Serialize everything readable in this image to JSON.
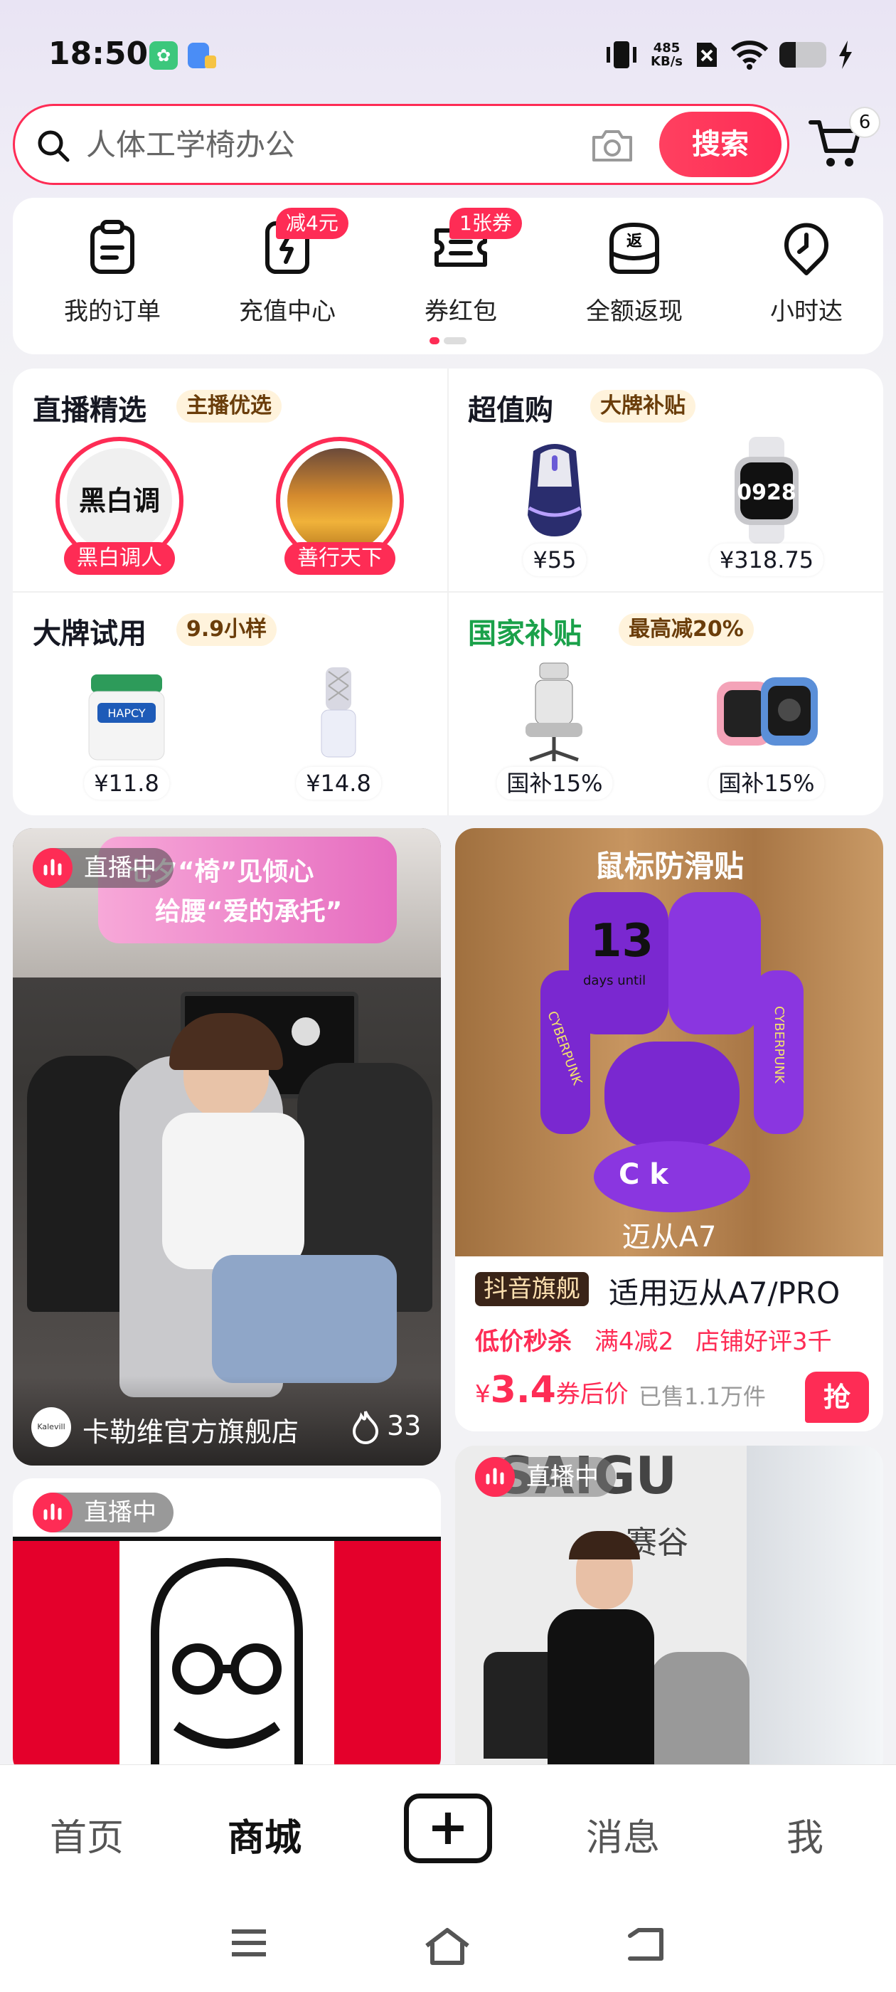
{
  "status": {
    "time": "18:50",
    "net_speed_top": "485",
    "net_speed_bottom": "KB/s",
    "battery_level": 0.35
  },
  "search": {
    "placeholder": "人体工学椅办公",
    "button": "搜索",
    "cart_count": "6"
  },
  "quick_entries": [
    {
      "label": "我的订单",
      "icon": "order-icon",
      "badge": ""
    },
    {
      "label": "充值中心",
      "icon": "phone-charge-icon",
      "badge": "减4元"
    },
    {
      "label": "券红包",
      "icon": "coupon-icon",
      "badge": "1张券"
    },
    {
      "label": "全额返现",
      "icon": "cashback-icon",
      "badge": ""
    },
    {
      "label": "小时达",
      "icon": "clock-pin-icon",
      "badge": ""
    }
  ],
  "sections": {
    "live_pick": {
      "title": "直播精选",
      "tag": "主播优选",
      "anchors": [
        {
          "name": "黑白调人",
          "logo_text": "黑白调"
        },
        {
          "name": "善行天下"
        }
      ]
    },
    "value_buy": {
      "title": "超值购",
      "tag": "大牌补贴",
      "products": [
        {
          "price": "¥55",
          "img": "mouse"
        },
        {
          "price": "¥318.75",
          "img": "smartwatch",
          "watch_text": "0928"
        }
      ]
    },
    "brand_trial": {
      "title": "大牌试用",
      "tag": "9.9小样",
      "products": [
        {
          "price": "¥11.8",
          "img": "cream-jar",
          "jar_text": "HAPCY"
        },
        {
          "price": "¥14.8",
          "img": "perfume-bottle"
        }
      ]
    },
    "gov_subsidy": {
      "title": "国家补贴",
      "tag": "最高减20%",
      "products": [
        {
          "price": "国补15%",
          "img": "office-chair"
        },
        {
          "price": "国补15%",
          "img": "kids-watch"
        }
      ]
    }
  },
  "feed": {
    "card1": {
      "live": "直播中",
      "banner_line1": "七夕“椅”见倾心",
      "banner_line2": "给腰“爱的承托”",
      "shop": "卡勒维官方旗舰店",
      "shop_logo": "Kalevill",
      "heat": "33"
    },
    "card2": {
      "image_title": "鼠标防滑贴",
      "image_caption": "迈从A7",
      "sticker_13": "13",
      "sticker_days": "days until",
      "cyber_text": "CYBERPUNK",
      "sticker_bottom": "C k",
      "flagship_tag": "抖音旗舰",
      "title": "适用迈从A7/PRO",
      "tag1": "低价秒杀",
      "tag2": "满4减2",
      "tag3": "店铺好评3千",
      "price_symbol": "¥",
      "price": "3.4",
      "price_suffix": "券后价",
      "sold": "已售1.1万件",
      "grab": "抢"
    },
    "card3": {
      "live": "直播中"
    },
    "card4": {
      "live": "直播中",
      "brand_en": "SAIGU",
      "brand_cn": "赛谷"
    }
  },
  "nav": {
    "home": "首页",
    "mall": "商城",
    "messages": "消息",
    "me": "我"
  },
  "colors": {
    "accent": "#fe2c55",
    "tag_bg": "#fff3dc",
    "subsidy_green": "#1aa14a"
  }
}
